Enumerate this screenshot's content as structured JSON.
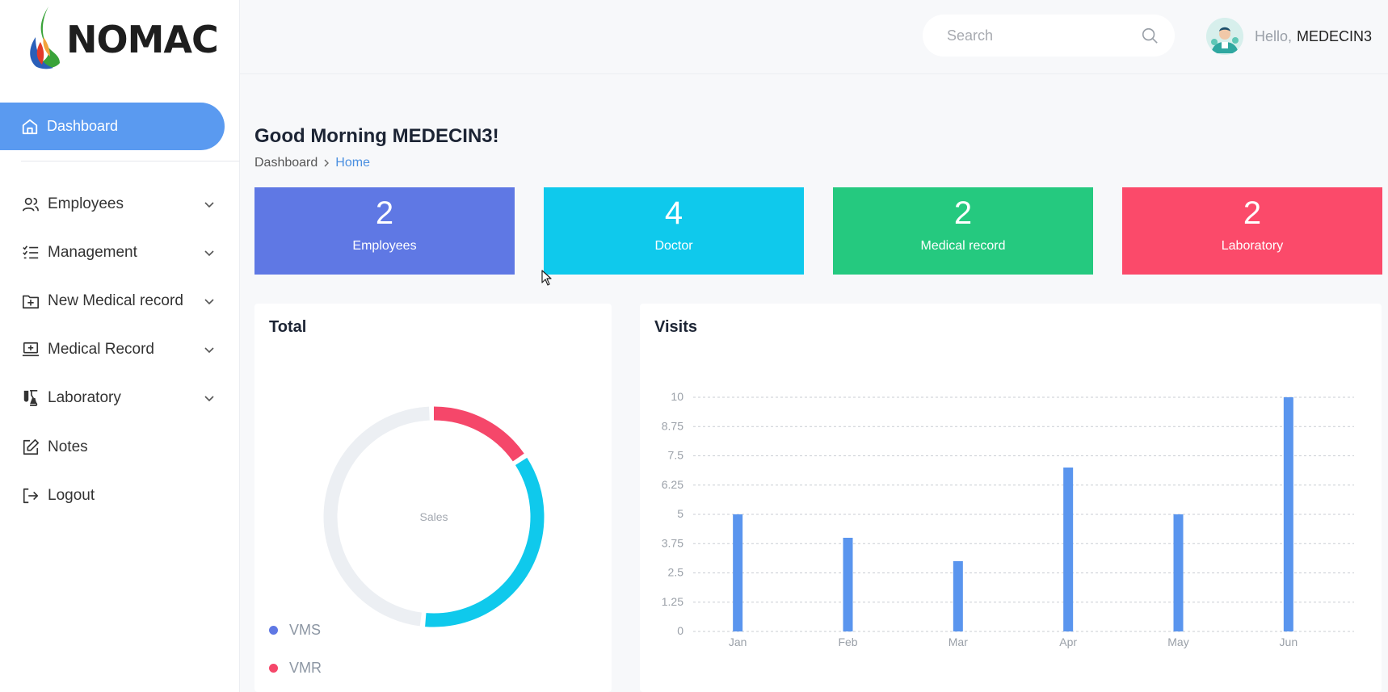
{
  "brand": {
    "name": "NOMAC"
  },
  "sidebar": {
    "active": {
      "label": "Dashboard",
      "icon": "home-icon"
    },
    "items": [
      {
        "label": "Employees",
        "icon": "users-icon",
        "has_children": true
      },
      {
        "label": "Management",
        "icon": "checklist-icon",
        "has_children": true
      },
      {
        "label": "New Medical record",
        "icon": "folder-plus-icon",
        "has_children": true
      },
      {
        "label": "Medical Record",
        "icon": "monitor-plus-icon",
        "has_children": true
      },
      {
        "label": "Laboratory",
        "icon": "flask-icon",
        "has_children": true
      },
      {
        "label": "Notes",
        "icon": "edit-icon",
        "has_children": false
      },
      {
        "label": "Logout",
        "icon": "logout-icon",
        "has_children": false
      }
    ]
  },
  "header": {
    "search_placeholder": "Search",
    "hello": "Hello,",
    "username": "MEDECIN3"
  },
  "main": {
    "greeting": "Good Morning MEDECIN3!",
    "breadcrumb": {
      "parent": "Dashboard",
      "current": "Home"
    },
    "stats": [
      {
        "value": "2",
        "label": "Employees",
        "color": "#5f78e4"
      },
      {
        "value": "4",
        "label": "Doctor",
        "color": "#0fc9ec"
      },
      {
        "value": "2",
        "label": "Medical record",
        "color": "#25c97f"
      },
      {
        "value": "2",
        "label": "Laboratory",
        "color": "#fb4a6a"
      }
    ],
    "total_card": {
      "title": "Total",
      "center_label": "Sales",
      "legend": [
        {
          "label": "VMS",
          "color": "#5f78e4"
        },
        {
          "label": "VMR",
          "color": "#f5476a"
        }
      ]
    },
    "visits_card": {
      "title": "Visits"
    }
  },
  "chart_data": [
    {
      "type": "pie",
      "title": "Total",
      "center_label": "Sales",
      "slices": [
        {
          "name": "VMR",
          "value": 16,
          "color": "#f5476a"
        },
        {
          "name": "",
          "value": 36,
          "color": "#0fc9ec"
        },
        {
          "name": "",
          "value": 48,
          "color": "#eceff3"
        }
      ]
    },
    {
      "type": "bar",
      "title": "Visits",
      "categories": [
        "Jan",
        "Feb",
        "Mar",
        "Apr",
        "May",
        "Jun"
      ],
      "values": [
        5,
        4,
        3,
        7,
        5,
        10
      ],
      "yticks": [
        "0",
        "1.25",
        "2.5",
        "3.75",
        "5",
        "6.25",
        "7.5",
        "8.75",
        "10"
      ],
      "ylim": [
        0,
        10
      ],
      "grid": true,
      "color": "#5a95ee"
    }
  ]
}
